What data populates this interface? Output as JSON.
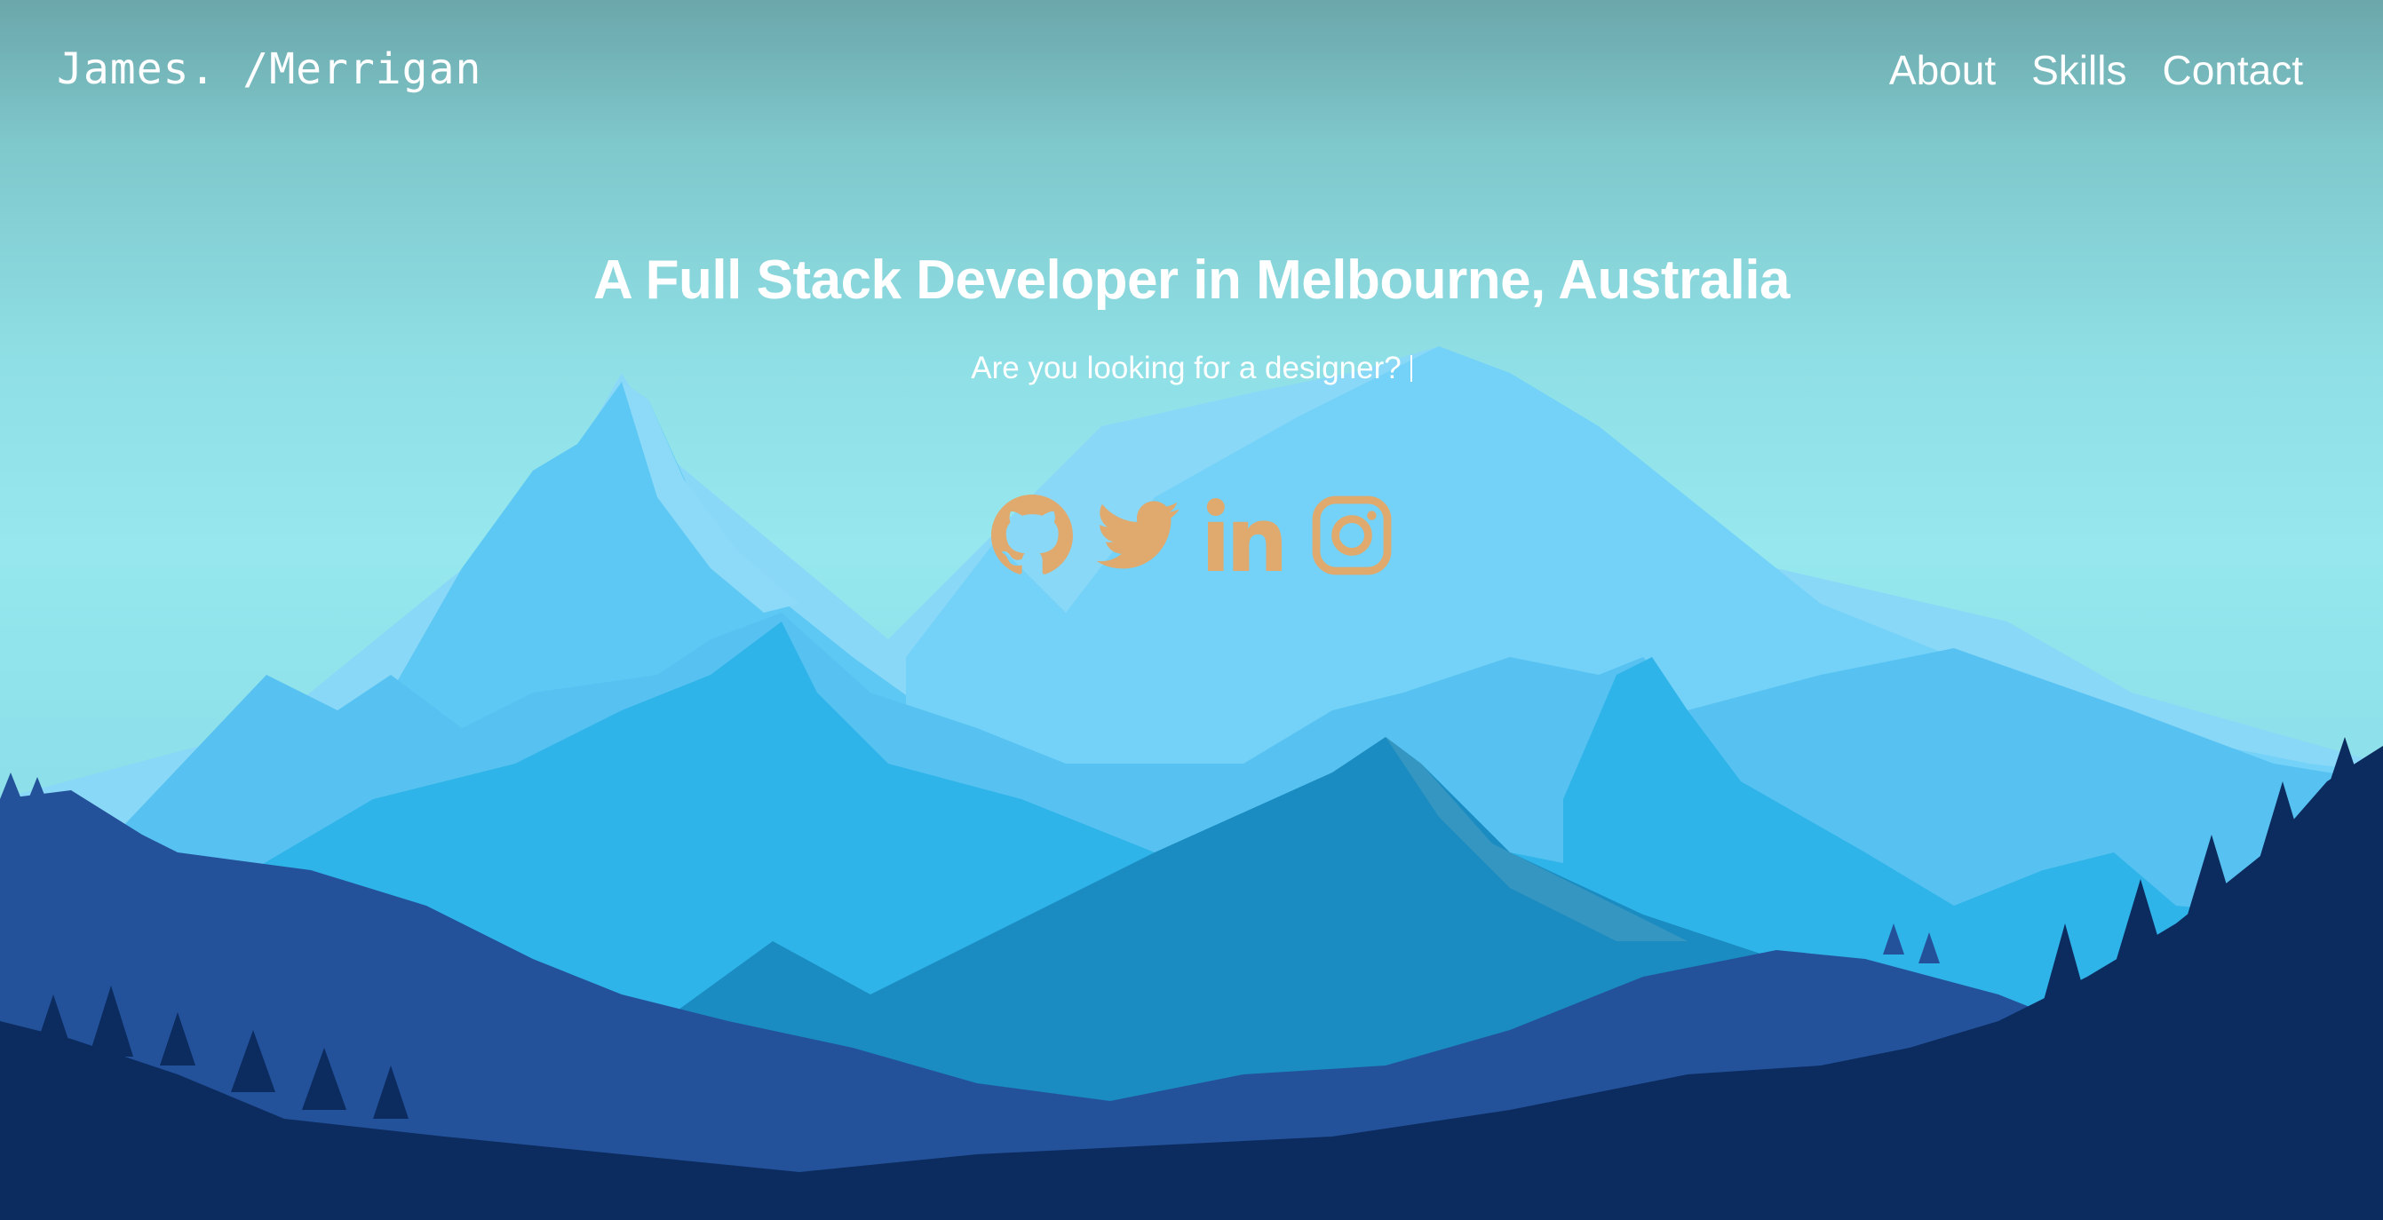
{
  "brand": {
    "text": "James. /Merrigan"
  },
  "nav": {
    "links": [
      {
        "label": "About"
      },
      {
        "label": "Skills"
      },
      {
        "label": "Contact"
      }
    ]
  },
  "hero": {
    "title": "A Full Stack Developer in Melbourne, Australia",
    "subtitle": "Are you looking for a designer?"
  },
  "socials": [
    {
      "icon": "github-icon"
    },
    {
      "icon": "twitter-icon"
    },
    {
      "icon": "linkedin-icon"
    },
    {
      "icon": "instagram-icon"
    }
  ],
  "colors": {
    "sky": "#96e8ee",
    "icon": "#e0a96d",
    "text": "#ffffff",
    "mountain_light": "#74d2f8",
    "mountain_mid": "#2fb4ea",
    "hill_dark": "#23529a",
    "forest_navy": "#0c2b5e"
  }
}
